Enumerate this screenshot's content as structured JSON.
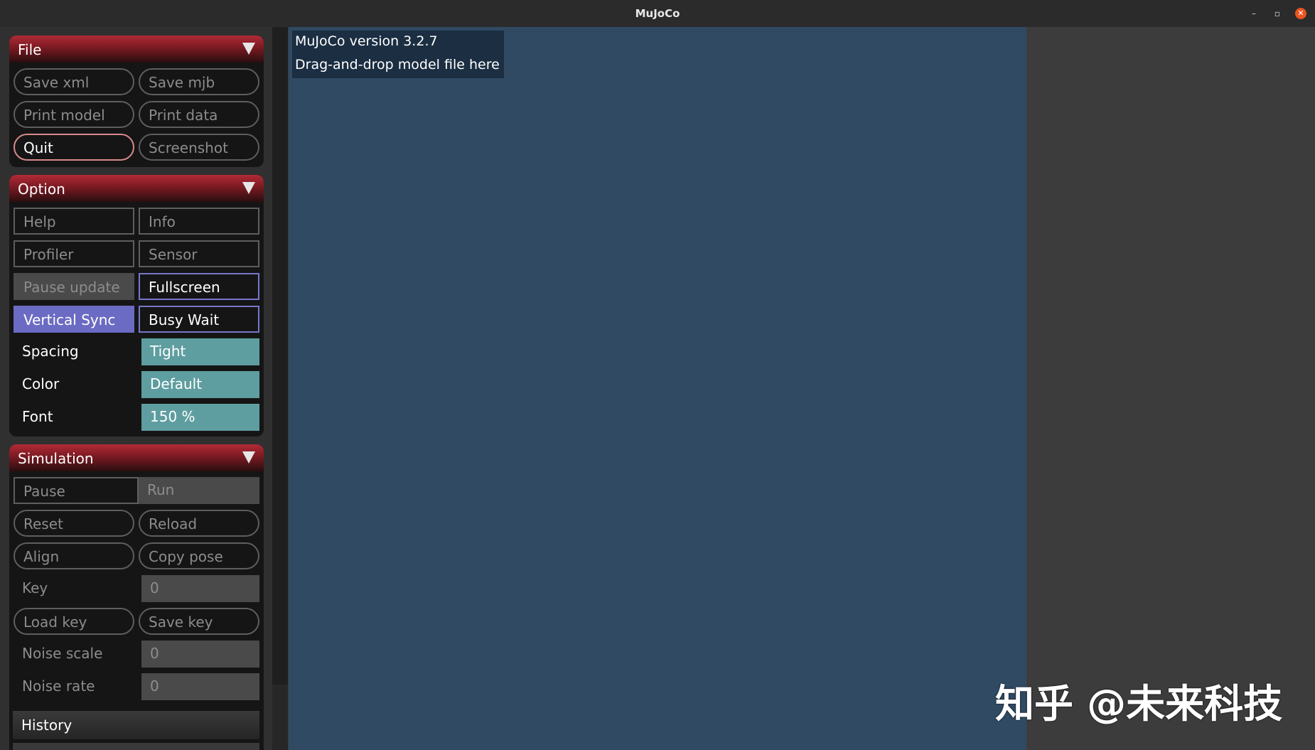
{
  "window": {
    "title": "MuJoCo",
    "minimize_glyph": "–",
    "maximize_glyph": "▫",
    "close_glyph": "✕"
  },
  "colors": {
    "viewport": "#304a64",
    "section_header": "#b12a36",
    "selected": "#6b6bc4",
    "dropdown": "#5f9ea0",
    "close_button": "#e95420"
  },
  "file": {
    "header": "File",
    "buttons": [
      "Save xml",
      "Save mjb",
      "Print model",
      "Print data",
      "Quit",
      "Screenshot"
    ]
  },
  "option": {
    "header": "Option",
    "toggles": [
      "Help",
      "Info",
      "Profiler",
      "Sensor",
      "Pause update",
      "Fullscreen",
      "Vertical Sync",
      "Busy Wait"
    ],
    "spacing_label": "Spacing",
    "spacing_value": "Tight",
    "color_label": "Color",
    "color_value": "Default",
    "font_label": "Font",
    "font_value": "150 %"
  },
  "simulation": {
    "header": "Simulation",
    "pause": "Pause",
    "run": "Run",
    "reset": "Reset",
    "reload": "Reload",
    "align": "Align",
    "copy_pose": "Copy pose",
    "key_label": "Key",
    "key_value": "0",
    "load_key": "Load key",
    "save_key": "Save key",
    "noise_scale_label": "Noise scale",
    "noise_scale_value": "0",
    "noise_rate_label": "Noise rate",
    "noise_rate_value": "0"
  },
  "history": {
    "header": "History"
  },
  "viewport": {
    "version_text": "MuJoCo version 3.2.7",
    "hint_text": "Drag-and-drop model file here"
  },
  "watermark": "知乎 @未来科技"
}
